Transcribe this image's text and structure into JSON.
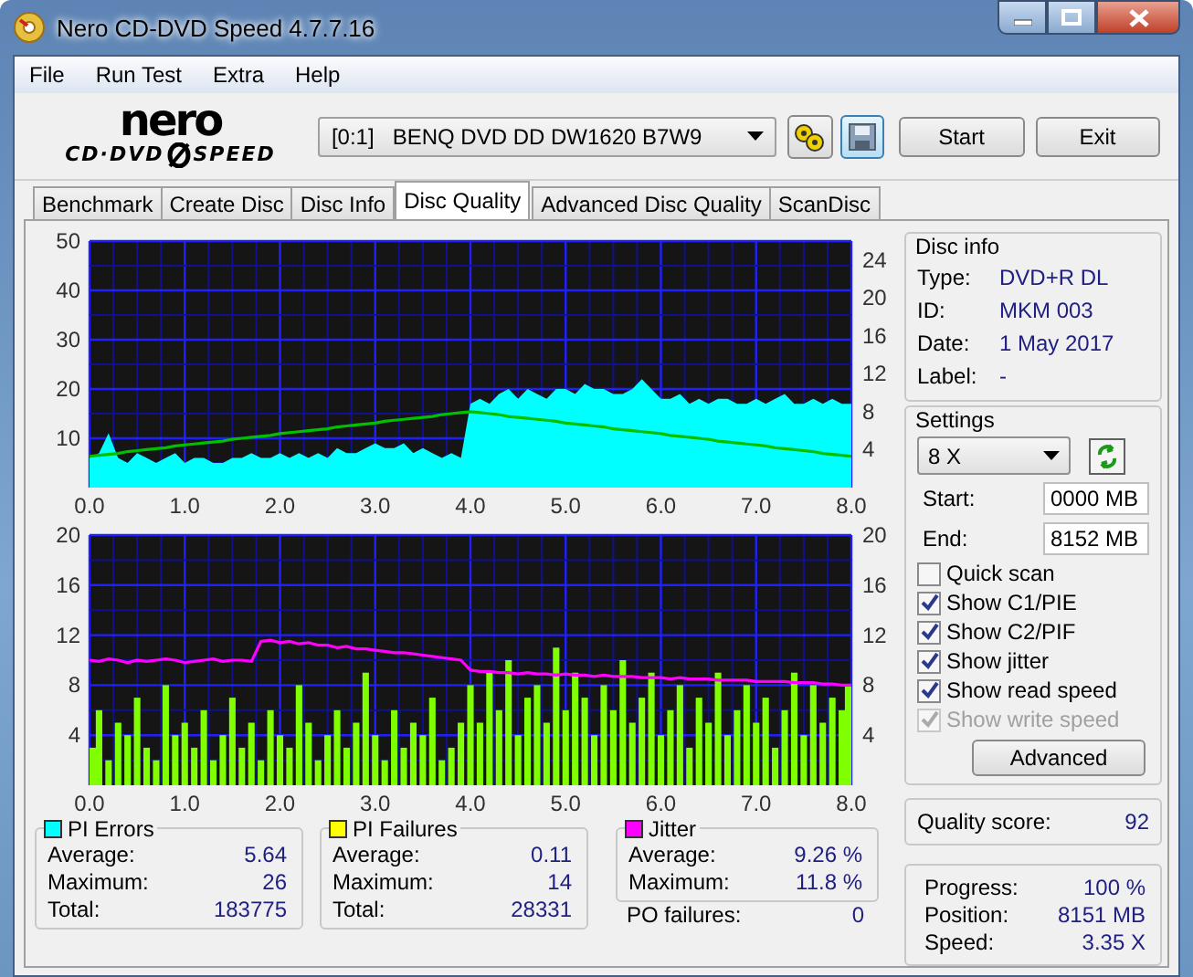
{
  "window": {
    "title": "Nero CD-DVD Speed 4.7.7.16"
  },
  "menu": [
    "File",
    "Run Test",
    "Extra",
    "Help"
  ],
  "logo": {
    "line1": "nero",
    "line2a": "CD·DVD",
    "line2b": "SPEED"
  },
  "drive": {
    "value": "[0:1]   BENQ DVD DD DW1620 B7W9"
  },
  "buttons": [
    "Start",
    "Exit"
  ],
  "tabs": [
    {
      "label": "Benchmark",
      "selected": false
    },
    {
      "label": "Create Disc",
      "selected": false
    },
    {
      "label": "Disc Info",
      "selected": false
    },
    {
      "label": "Disc Quality",
      "selected": true
    },
    {
      "label": "Advanced Disc Quality",
      "selected": false
    },
    {
      "label": "ScanDisc",
      "selected": false
    }
  ],
  "plots": [
    {
      "layers": [
        {
          "chart_data": {
            "type": "area",
            "grid": true,
            "xlim": [
              0,
              8
            ],
            "ylim": [
              0,
              50
            ],
            "x": [
              0,
              0.1,
              0.2,
              0.3,
              0.4,
              0.5,
              0.6,
              0.7,
              0.8,
              0.9,
              1,
              1.1,
              1.2,
              1.3,
              1.4,
              1.5,
              1.6,
              1.7,
              1.8,
              1.9,
              2,
              2.1,
              2.2,
              2.3,
              2.4,
              2.5,
              2.6,
              2.7,
              2.8,
              2.9,
              3,
              3.1,
              3.2,
              3.3,
              3.4,
              3.5,
              3.6,
              3.7,
              3.8,
              3.9,
              4,
              4.1,
              4.2,
              4.3,
              4.4,
              4.5,
              4.6,
              4.7,
              4.8,
              4.9,
              5,
              5.1,
              5.2,
              5.3,
              5.4,
              5.5,
              5.6,
              5.7,
              5.8,
              5.9,
              6,
              6.1,
              6.2,
              6.3,
              6.4,
              6.5,
              6.6,
              6.7,
              6.8,
              6.9,
              7,
              7.1,
              7.2,
              7.3,
              7.4,
              7.5,
              7.6,
              7.7,
              7.8,
              7.9,
              8
            ],
            "xticks": [
              {
                "value": 0,
                "label": "0.0"
              },
              {
                "value": 1,
                "label": "1.0"
              },
              {
                "value": 2,
                "label": "2.0"
              },
              {
                "value": 3,
                "label": "3.0"
              },
              {
                "value": 4,
                "label": "4.0"
              },
              {
                "value": 5,
                "label": "5.0"
              },
              {
                "value": 6,
                "label": "6.0"
              },
              {
                "value": 7,
                "label": "7.0"
              },
              {
                "value": 8,
                "label": "8.0"
              }
            ],
            "yticks": [
              10,
              20,
              30,
              40,
              50
            ],
            "series": [
              {
                "color": "#00ffff",
                "values": [
                  6,
                  7,
                  11,
                  6,
                  5,
                  7,
                  6,
                  5,
                  6,
                  7,
                  5,
                  6,
                  6,
                  5,
                  5,
                  6,
                  6,
                  7,
                  6,
                  6,
                  7,
                  6,
                  7,
                  6,
                  7,
                  6,
                  8,
                  7,
                  7,
                  8,
                  9,
                  8,
                  8,
                  9,
                  7,
                  8,
                  7,
                  6,
                  7,
                  6,
                  17,
                  18,
                  17,
                  19,
                  20,
                  18,
                  20,
                  19,
                  18,
                  20,
                  20,
                  19,
                  21,
                  20,
                  20,
                  19,
                  19,
                  20,
                  22,
                  20,
                  18,
                  18,
                  19,
                  17,
                  18,
                  17,
                  18,
                  18,
                  17,
                  17,
                  18,
                  17,
                  18,
                  19,
                  17,
                  17,
                  18,
                  17,
                  18,
                  17,
                  17
                ]
              }
            ]
          }
        },
        {
          "chart_data": {
            "type": "line",
            "xlim": [
              0,
              8
            ],
            "ylim": [
              0,
              26
            ],
            "x": [
              0,
              0.1,
              0.2,
              0.3,
              0.4,
              0.5,
              0.6,
              0.7,
              0.8,
              0.9,
              1,
              1.1,
              1.2,
              1.3,
              1.4,
              1.5,
              1.6,
              1.7,
              1.8,
              1.9,
              2,
              2.1,
              2.2,
              2.3,
              2.4,
              2.5,
              2.6,
              2.7,
              2.8,
              2.9,
              3,
              3.1,
              3.2,
              3.3,
              3.4,
              3.5,
              3.6,
              3.7,
              3.8,
              3.9,
              4,
              4.1,
              4.2,
              4.3,
              4.4,
              4.5,
              4.6,
              4.7,
              4.8,
              4.9,
              5,
              5.1,
              5.2,
              5.3,
              5.4,
              5.5,
              5.6,
              5.7,
              5.8,
              5.9,
              6,
              6.1,
              6.2,
              6.3,
              6.4,
              6.5,
              6.6,
              6.7,
              6.8,
              6.9,
              7,
              7.1,
              7.2,
              7.3,
              7.4,
              7.5,
              7.6,
              7.7,
              7.8,
              7.9,
              8
            ],
            "yticks": [
              4,
              8,
              12,
              16,
              20,
              24
            ],
            "series": [
              {
                "color": "#00c000",
                "values": [
                  3.3,
                  3.4,
                  3.5,
                  3.6,
                  3.8,
                  3.9,
                  4.0,
                  4.1,
                  4.2,
                  4.4,
                  4.5,
                  4.6,
                  4.7,
                  4.8,
                  4.9,
                  5.1,
                  5.2,
                  5.3,
                  5.4,
                  5.5,
                  5.7,
                  5.8,
                  5.9,
                  6.0,
                  6.1,
                  6.2,
                  6.4,
                  6.5,
                  6.6,
                  6.7,
                  6.8,
                  7.0,
                  7.1,
                  7.2,
                  7.3,
                  7.4,
                  7.5,
                  7.7,
                  7.8,
                  7.9,
                  8.0,
                  7.9,
                  7.8,
                  7.7,
                  7.5,
                  7.4,
                  7.3,
                  7.2,
                  7.1,
                  7.0,
                  6.8,
                  6.7,
                  6.6,
                  6.5,
                  6.4,
                  6.2,
                  6.1,
                  6.0,
                  5.9,
                  5.8,
                  5.7,
                  5.5,
                  5.4,
                  5.3,
                  5.2,
                  5.1,
                  4.9,
                  4.8,
                  4.7,
                  4.6,
                  4.5,
                  4.4,
                  4.2,
                  4.1,
                  4.0,
                  3.9,
                  3.8,
                  3.6,
                  3.5,
                  3.4,
                  3.3
                ]
              }
            ]
          }
        }
      ]
    },
    {
      "layers": [
        {
          "chart_data": {
            "type": "bar",
            "grid": true,
            "xlim": [
              0,
              8
            ],
            "ylim": [
              0,
              20
            ],
            "x": [
              0,
              0.1,
              0.2,
              0.3,
              0.4,
              0.5,
              0.6,
              0.7,
              0.8,
              0.9,
              1,
              1.1,
              1.2,
              1.3,
              1.4,
              1.5,
              1.6,
              1.7,
              1.8,
              1.9,
              2,
              2.1,
              2.2,
              2.3,
              2.4,
              2.5,
              2.6,
              2.7,
              2.8,
              2.9,
              3,
              3.1,
              3.2,
              3.3,
              3.4,
              3.5,
              3.6,
              3.7,
              3.8,
              3.9,
              4,
              4.1,
              4.2,
              4.3,
              4.4,
              4.5,
              4.6,
              4.7,
              4.8,
              4.9,
              5,
              5.1,
              5.2,
              5.3,
              5.4,
              5.5,
              5.6,
              5.7,
              5.8,
              5.9,
              6,
              6.1,
              6.2,
              6.3,
              6.4,
              6.5,
              6.6,
              6.7,
              6.8,
              6.9,
              7,
              7.1,
              7.2,
              7.3,
              7.4,
              7.5,
              7.6,
              7.7,
              7.8,
              7.9,
              8
            ],
            "xticks": [
              {
                "value": 0,
                "label": "0.0"
              },
              {
                "value": 1,
                "label": "1.0"
              },
              {
                "value": 2,
                "label": "2.0"
              },
              {
                "value": 3,
                "label": "3.0"
              },
              {
                "value": 4,
                "label": "4.0"
              },
              {
                "value": 5,
                "label": "5.0"
              },
              {
                "value": 6,
                "label": "6.0"
              },
              {
                "value": 7,
                "label": "7.0"
              },
              {
                "value": 8,
                "label": "8.0"
              }
            ],
            "yticks": [
              4,
              8,
              12,
              16,
              20
            ],
            "series": [
              {
                "color": "#80ff00",
                "values": [
                  3,
                  6,
                  2,
                  5,
                  4,
                  7,
                  3,
                  2,
                  8,
                  4,
                  5,
                  3,
                  6,
                  2,
                  4,
                  7,
                  3,
                  5,
                  2,
                  6,
                  4,
                  3,
                  8,
                  5,
                  2,
                  4,
                  6,
                  3,
                  5,
                  9,
                  4,
                  2,
                  6,
                  3,
                  5,
                  4,
                  7,
                  2,
                  3,
                  5,
                  8,
                  5,
                  9,
                  6,
                  10,
                  4,
                  7,
                  8,
                  5,
                  11,
                  6,
                  9,
                  7,
                  4,
                  8,
                  6,
                  10,
                  5,
                  7,
                  9,
                  4,
                  6,
                  8,
                  3,
                  7,
                  5,
                  9,
                  4,
                  6,
                  8,
                  5,
                  7,
                  3,
                  6,
                  9,
                  4,
                  8,
                  5,
                  7,
                  6,
                  8
                ]
              }
            ]
          }
        },
        {
          "chart_data": {
            "type": "line",
            "xlim": [
              0,
              8
            ],
            "ylim": [
              0,
              20
            ],
            "x": [
              0,
              0.1,
              0.2,
              0.3,
              0.4,
              0.5,
              0.6,
              0.7,
              0.8,
              0.9,
              1,
              1.1,
              1.2,
              1.3,
              1.4,
              1.5,
              1.6,
              1.7,
              1.8,
              1.9,
              2,
              2.1,
              2.2,
              2.3,
              2.4,
              2.5,
              2.6,
              2.7,
              2.8,
              2.9,
              3,
              3.1,
              3.2,
              3.3,
              3.4,
              3.5,
              3.6,
              3.7,
              3.8,
              3.9,
              4,
              4.1,
              4.2,
              4.3,
              4.4,
              4.5,
              4.6,
              4.7,
              4.8,
              4.9,
              5,
              5.1,
              5.2,
              5.3,
              5.4,
              5.5,
              5.6,
              5.7,
              5.8,
              5.9,
              6,
              6.1,
              6.2,
              6.3,
              6.4,
              6.5,
              6.6,
              6.7,
              6.8,
              6.9,
              7,
              7.1,
              7.2,
              7.3,
              7.4,
              7.5,
              7.6,
              7.7,
              7.8,
              7.9,
              8
            ],
            "yticks": [
              4,
              8,
              12,
              16,
              20
            ],
            "series": [
              {
                "color": "#ff00ff",
                "values": [
                  10.0,
                  9.9,
                  10.1,
                  10.0,
                  9.8,
                  10.0,
                  9.9,
                  10.0,
                  10.1,
                  10.0,
                  9.8,
                  9.9,
                  10.0,
                  10.1,
                  9.9,
                  10.0,
                  10.0,
                  9.9,
                  11.5,
                  11.6,
                  11.4,
                  11.5,
                  11.3,
                  11.4,
                  11.2,
                  11.2,
                  11.0,
                  11.1,
                  10.9,
                  10.9,
                  10.8,
                  10.7,
                  10.6,
                  10.6,
                  10.5,
                  10.4,
                  10.3,
                  10.2,
                  10.1,
                  10.0,
                  9.2,
                  9.1,
                  9.1,
                  9.0,
                  9.0,
                  8.9,
                  9.0,
                  8.9,
                  8.9,
                  8.8,
                  8.9,
                  8.8,
                  8.8,
                  8.7,
                  8.8,
                  8.7,
                  8.7,
                  8.7,
                  8.6,
                  8.6,
                  8.6,
                  8.5,
                  8.6,
                  8.5,
                  8.5,
                  8.5,
                  8.4,
                  8.4,
                  8.4,
                  8.4,
                  8.3,
                  8.3,
                  8.3,
                  8.3,
                  8.2,
                  8.2,
                  8.2,
                  8.1,
                  8.1,
                  8.0,
                  8.0
                ]
              }
            ]
          }
        }
      ]
    }
  ],
  "disc_info": {
    "title": "Disc info",
    "rows": [
      {
        "label": "Type:",
        "value": "DVD+R DL"
      },
      {
        "label": "ID:",
        "value": "MKM 003"
      },
      {
        "label": "Date:",
        "value": "1 May 2017"
      },
      {
        "label": "Label:",
        "value": "-"
      }
    ]
  },
  "settings": {
    "title": "Settings",
    "speed": "8 X",
    "fields": [
      {
        "label": "Start:",
        "value": "0000 MB"
      },
      {
        "label": "End:",
        "value": "8152 MB"
      }
    ],
    "options": [
      {
        "label": "Quick scan",
        "checked": false,
        "disabled": false
      },
      {
        "label": "Show C1/PIE",
        "checked": true,
        "disabled": false
      },
      {
        "label": "Show C2/PIF",
        "checked": true,
        "disabled": false
      },
      {
        "label": "Show jitter",
        "checked": true,
        "disabled": false
      },
      {
        "label": "Show read speed",
        "checked": true,
        "disabled": false
      },
      {
        "label": "Show write speed",
        "checked": true,
        "disabled": true
      }
    ],
    "advanced": "Advanced"
  },
  "quality": {
    "label": "Quality score:",
    "value": "92"
  },
  "stats": [
    {
      "title": "PI Errors",
      "color": "#00ffff",
      "rows": [
        {
          "label": "Average:",
          "value": "5.64"
        },
        {
          "label": "Maximum:",
          "value": "26"
        },
        {
          "label": "Total:",
          "value": "183775"
        }
      ]
    },
    {
      "title": "PI Failures",
      "color": "#ffff00",
      "rows": [
        {
          "label": "Average:",
          "value": "0.11"
        },
        {
          "label": "Maximum:",
          "value": "14"
        },
        {
          "label": "Total:",
          "value": "28331"
        }
      ]
    },
    {
      "title": "Jitter",
      "color": "#ff00ff",
      "rows": [
        {
          "label": "Average:",
          "value": "9.26 %"
        },
        {
          "label": "Maximum:",
          "value": "11.8 %"
        }
      ]
    }
  ],
  "po_failures": {
    "label": "PO failures:",
    "value": "0"
  },
  "progress": [
    {
      "label": "Progress:",
      "value": "100 %"
    },
    {
      "label": "Position:",
      "value": "8151 MB"
    },
    {
      "label": "Speed:",
      "value": "3.35 X"
    }
  ]
}
